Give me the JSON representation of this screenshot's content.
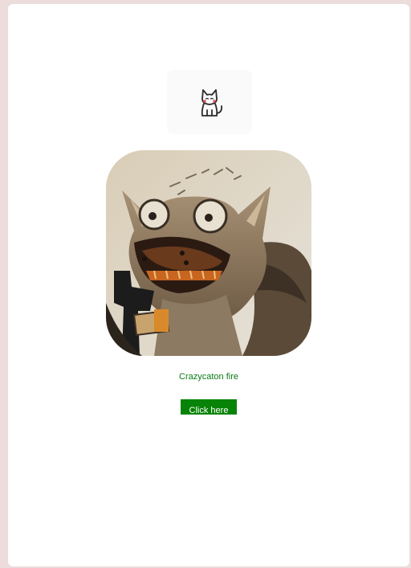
{
  "brand": {
    "logo_icon": "cat-icon"
  },
  "profile": {
    "image_icon": "fire-cat-artwork",
    "caption": "Crazycaton fire"
  },
  "actions": {
    "cta_label": "Click here"
  },
  "colors": {
    "page_background": "#ecdcdc",
    "card_background": "#ffffff",
    "caption_text": "#0b7a16",
    "button_background": "#078307",
    "button_text": "#ffffff"
  }
}
